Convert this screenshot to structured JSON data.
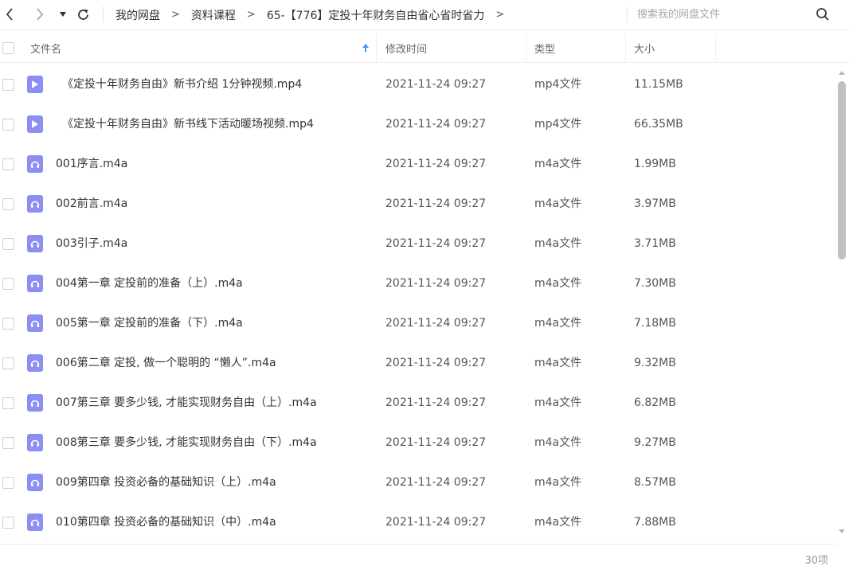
{
  "nav": {
    "breadcrumbs": [
      "我的网盘",
      "资料课程",
      "65-【776】定投十年财务自由省心省时省力"
    ],
    "separator": ">",
    "search_placeholder": "搜索我的网盘文件"
  },
  "header": {
    "name": "文件名",
    "modified": "修改时间",
    "type": "类型",
    "size": "大小"
  },
  "colors": {
    "icon_video": "#8b8ff2",
    "icon_audio": "#8b8ff2",
    "sort_arrow": "#3c94f5"
  },
  "files": [
    {
      "name": "《定投十年财务自由》新书介绍 1分钟视频.mp4",
      "time": "2021-11-24 09:27",
      "type": "mp4文件",
      "size": "11.15MB",
      "icon": "video-icon"
    },
    {
      "name": "《定投十年财务自由》新书线下活动暖场视频.mp4",
      "time": "2021-11-24 09:27",
      "type": "mp4文件",
      "size": "66.35MB",
      "icon": "video-icon"
    },
    {
      "name": "001序言.m4a",
      "time": "2021-11-24 09:27",
      "type": "m4a文件",
      "size": "1.99MB",
      "icon": "audio-icon"
    },
    {
      "name": "002前言.m4a",
      "time": "2021-11-24 09:27",
      "type": "m4a文件",
      "size": "3.97MB",
      "icon": "audio-icon"
    },
    {
      "name": "003引子.m4a",
      "time": "2021-11-24 09:27",
      "type": "m4a文件",
      "size": "3.71MB",
      "icon": "audio-icon"
    },
    {
      "name": "004第一章 定投前的准备（上）.m4a",
      "time": "2021-11-24 09:27",
      "type": "m4a文件",
      "size": "7.30MB",
      "icon": "audio-icon"
    },
    {
      "name": "005第一章 定投前的准备（下）.m4a",
      "time": "2021-11-24 09:27",
      "type": "m4a文件",
      "size": "7.18MB",
      "icon": "audio-icon"
    },
    {
      "name": "006第二章 定投, 做一个聪明的 “懒人”.m4a",
      "time": "2021-11-24 09:27",
      "type": "m4a文件",
      "size": "9.32MB",
      "icon": "audio-icon"
    },
    {
      "name": "007第三章 要多少钱, 才能实现财务自由（上）.m4a",
      "time": "2021-11-24 09:27",
      "type": "m4a文件",
      "size": "6.82MB",
      "icon": "audio-icon"
    },
    {
      "name": "008第三章 要多少钱, 才能实现财务自由（下）.m4a",
      "time": "2021-11-24 09:27",
      "type": "m4a文件",
      "size": "9.27MB",
      "icon": "audio-icon"
    },
    {
      "name": "009第四章 投资必备的基础知识（上）.m4a",
      "time": "2021-11-24 09:27",
      "type": "m4a文件",
      "size": "8.57MB",
      "icon": "audio-icon"
    },
    {
      "name": "010第四章 投资必备的基础知识（中）.m4a",
      "time": "2021-11-24 09:27",
      "type": "m4a文件",
      "size": "7.88MB",
      "icon": "audio-icon"
    }
  ],
  "footer": {
    "count": "30项"
  }
}
